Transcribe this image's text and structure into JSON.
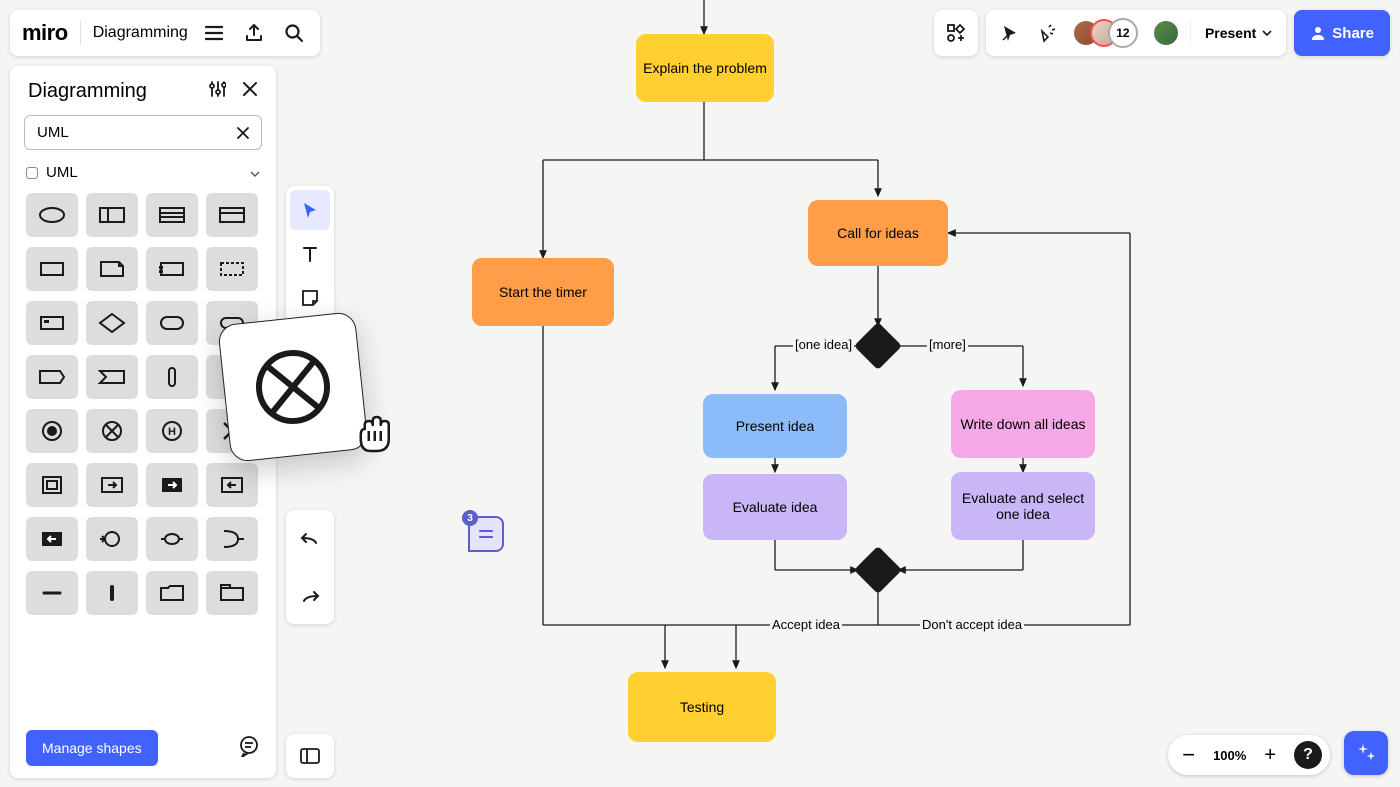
{
  "app": {
    "logo": "miro",
    "board_name": "Diagramming"
  },
  "sidebar": {
    "title": "Diagramming",
    "search_value": "UML",
    "category_label": "UML",
    "shapes": [
      "ellipse",
      "interface",
      "component",
      "class",
      "rect",
      "note",
      "container",
      "dashed-rect",
      "action",
      "decision-small",
      "rounded",
      "pill",
      "signal-send",
      "signal-receive",
      "bar-v",
      "filled-circle",
      "circle-dot",
      "circle-x",
      "circle-h",
      "x",
      "square",
      "square-arrow-out",
      "square-arrow-fill",
      "square-arrow-in",
      "square-fill-arrow",
      "connector",
      "oval-h",
      "receive-signal",
      "minus",
      "bar-short",
      "folder",
      "package"
    ],
    "manage_label": "Manage shapes"
  },
  "vtoolbar": {
    "tools": [
      {
        "name": "select",
        "selected": true
      },
      {
        "name": "text",
        "selected": false
      },
      {
        "name": "sticky",
        "selected": false
      },
      {
        "name": "shapes-badge",
        "selected": false
      },
      {
        "name": "more",
        "selected": false
      }
    ]
  },
  "topright": {
    "collaborator_count": "12",
    "present_label": "Present",
    "share_label": "Share"
  },
  "flowchart": {
    "nodes": {
      "explain": "Explain the problem",
      "call": "Call for ideas",
      "timer": "Start the timer",
      "present": "Present idea",
      "writedown": "Write down all ideas",
      "evaluate": "Evaluate idea",
      "evaluate_select": "Evaluate and select one idea",
      "testing": "Testing"
    },
    "labels": {
      "one_idea": "[one idea]",
      "more": "[more]",
      "accept": "Accept idea",
      "dont": "Don't accept idea"
    }
  },
  "comment": {
    "count": "3"
  },
  "zoom": {
    "level": "100%"
  }
}
